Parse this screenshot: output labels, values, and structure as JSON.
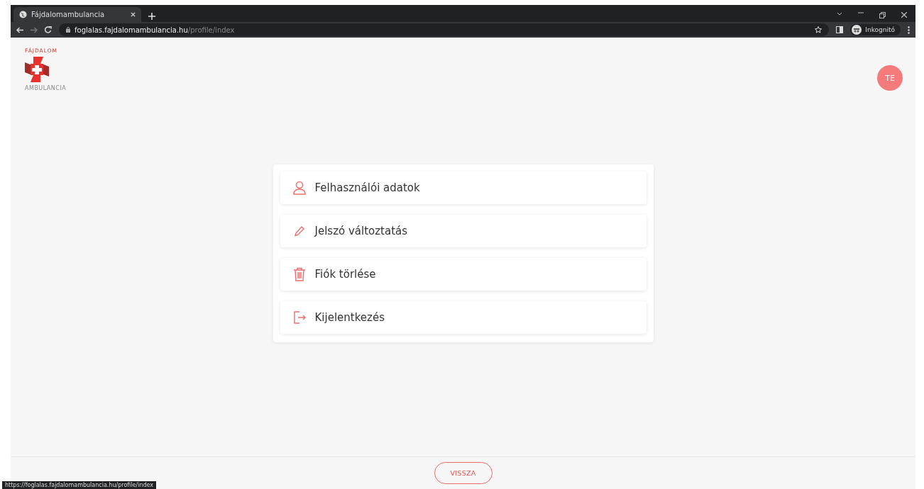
{
  "browser": {
    "tab_title": "Fájdalomambulancia",
    "url_host": "foglalas.fajdalomambulancia.hu",
    "url_path": "/profile/index",
    "profile_label": "Inkognitó",
    "status_url": "https://foglalas.fajdalomambulancia.hu/profile/index"
  },
  "logo": {
    "top_text": "FÁJDALOM",
    "bottom_text": "AMBULANCIA"
  },
  "avatar": {
    "initials": "TE"
  },
  "menu": [
    {
      "label": "Felhasználói adatok"
    },
    {
      "label": "Jelszó változtatás"
    },
    {
      "label": "Fiók törlése"
    },
    {
      "label": "Kijelentkezés"
    }
  ],
  "back_button": {
    "label": "VISSZA"
  }
}
